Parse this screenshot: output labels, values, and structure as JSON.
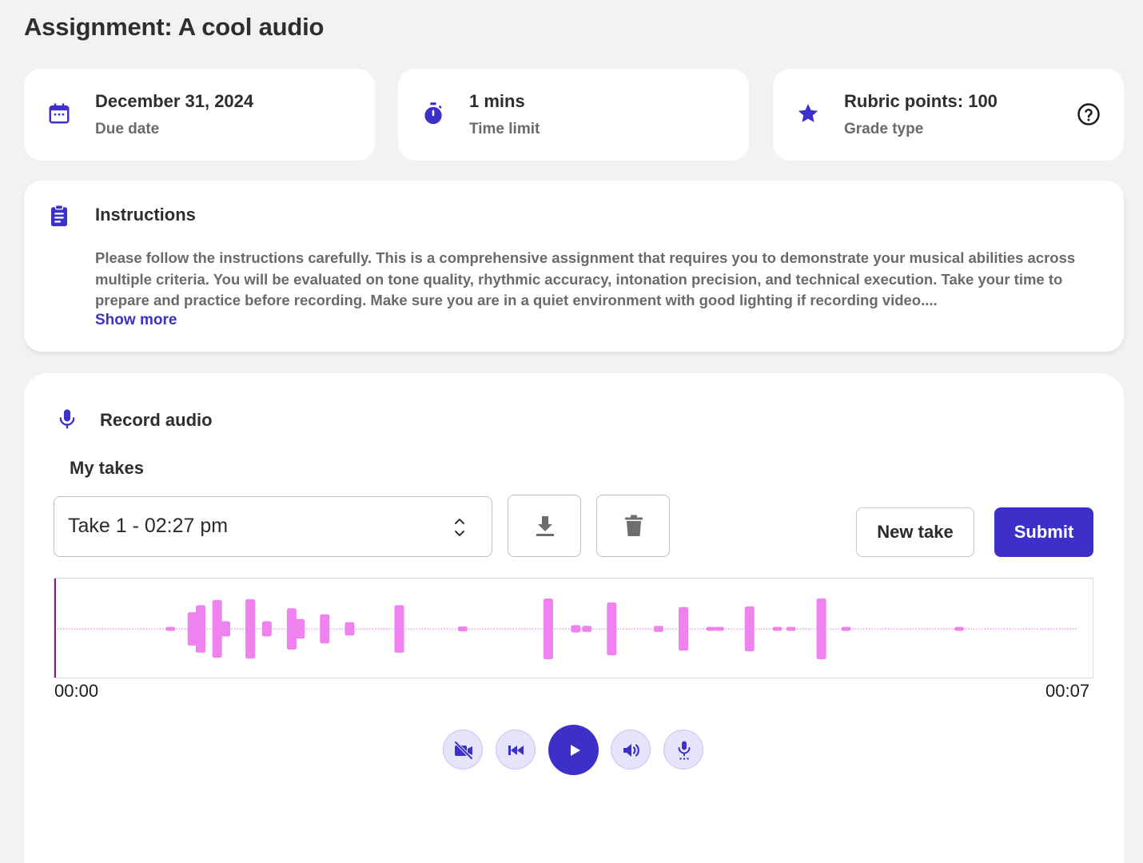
{
  "page_title": "Assignment: A cool audio",
  "info_cards": [
    {
      "icon": "calendar-icon",
      "value": "December 31, 2024",
      "label": "Due date"
    },
    {
      "icon": "stopwatch-icon",
      "value": "1 mins",
      "label": "Time limit"
    },
    {
      "icon": "star-icon",
      "value": "Rubric points: 100",
      "label": "Grade type",
      "help_icon": "help-circle-icon"
    }
  ],
  "instructions": {
    "heading": "Instructions",
    "body": "Please follow the instructions carefully. This is a comprehensive assignment that requires you to demonstrate your musical abilities across multiple criteria. You will be evaluated on tone quality, rhythmic accuracy, intonation precision, and technical execution. Take your time to prepare and practice before recording. Make sure you are in a quiet environment with good lighting if recording video....",
    "show_more": "Show more"
  },
  "recorder": {
    "title": "Record audio",
    "takes_label": "My takes",
    "selected_take": "Take 1 - 02:27 pm",
    "new_take_label": "New take",
    "submit_label": "Submit",
    "time_start": "00:00",
    "time_end": "00:07",
    "waveform_peaks": [
      0.02,
      0.02,
      0.02,
      0.02,
      0.02,
      0.02,
      0.02,
      0.02,
      0.02,
      0.02,
      0.02,
      0.02,
      0.02,
      0.02,
      0.02,
      0.02,
      0.02,
      0.02,
      0.02,
      0.02,
      0.02,
      0.02,
      0.02,
      0.02,
      0.02,
      0.02,
      0.02,
      0.02,
      0.02,
      0.02,
      0.02,
      0.02,
      0.02,
      0.02,
      0.02,
      0.02,
      0.02,
      0.02,
      0.02,
      0.02,
      0.05,
      0.02,
      0.02,
      0.02,
      0.02,
      0.02,
      0.02,
      0.02,
      0.55,
      0.02,
      0.02,
      0.78,
      0.02,
      0.02,
      0.02,
      0.02,
      0.02,
      0.95,
      0.02,
      0.02,
      0.25,
      0.02,
      0.02,
      0.02,
      0.02,
      0.02,
      0.02,
      0.02,
      0.02,
      0.98,
      0.02,
      0.02,
      0.02,
      0.02,
      0.02,
      0.25,
      0.02,
      0.02,
      0.02,
      0.02,
      0.02,
      0.02,
      0.02,
      0.02,
      0.68,
      0.02,
      0.02,
      0.32,
      0.02,
      0.02,
      0.02,
      0.02,
      0.02,
      0.02,
      0.02,
      0.02,
      0.48,
      0.02,
      0.02,
      0.02,
      0.02,
      0.02,
      0.02,
      0.02,
      0.02,
      0.22,
      0.02,
      0.02,
      0.02,
      0.02,
      0.02,
      0.02,
      0.02,
      0.02,
      0.02,
      0.02,
      0.02,
      0.02,
      0.02,
      0.02,
      0.02,
      0.02,
      0.02,
      0.78,
      0.02,
      0.02,
      0.02,
      0.02,
      0.02,
      0.02,
      0.02,
      0.02,
      0.02,
      0.02,
      0.02,
      0.02,
      0.02,
      0.02,
      0.02,
      0.02,
      0.02,
      0.02,
      0.02,
      0.02,
      0.02,
      0.02,
      0.08,
      0.02,
      0.02,
      0.02,
      0.02,
      0.02,
      0.02,
      0.02,
      0.02,
      0.02,
      0.02,
      0.02,
      0.02,
      0.02,
      0.02,
      0.02,
      0.02,
      0.02,
      0.02,
      0.02,
      0.02,
      0.02,
      0.02,
      0.02,
      0.02,
      0.02,
      0.02,
      0.02,
      0.02,
      0.02,
      0.02,
      1.0,
      0.02,
      0.02,
      0.02,
      0.02,
      0.02,
      0.02,
      0.02,
      0.02,
      0.02,
      0.12,
      0.02,
      0.02,
      0.02,
      0.1,
      0.02,
      0.02,
      0.02,
      0.02,
      0.02,
      0.02,
      0.02,
      0.02,
      0.87,
      0.02,
      0.02,
      0.02,
      0.02,
      0.02,
      0.02,
      0.02,
      0.02,
      0.02,
      0.02,
      0.02,
      0.02,
      0.02,
      0.02,
      0.02,
      0.02,
      0.1,
      0.02,
      0.02,
      0.02,
      0.02,
      0.02,
      0.02,
      0.02,
      0.02,
      0.72,
      0.02,
      0.02,
      0.02,
      0.02,
      0.02,
      0.02,
      0.02,
      0.02,
      0.02,
      0.04,
      0.02,
      0.02,
      0.04,
      0.02,
      0.02,
      0.02,
      0.02,
      0.02,
      0.02,
      0.02,
      0.02,
      0.02,
      0.02,
      0.74,
      0.02,
      0.02,
      0.02,
      0.02,
      0.02,
      0.02,
      0.02,
      0.02,
      0.02,
      0.04,
      0.02,
      0.02,
      0.02,
      0.02,
      0.04,
      0.02,
      0.02,
      0.02,
      0.02,
      0.02,
      0.02,
      0.02,
      0.02,
      0.02,
      0.02,
      1.0,
      0.02,
      0.02,
      0.02,
      0.02,
      0.02,
      0.02,
      0.02,
      0.02,
      0.06,
      0.02,
      0.02,
      0.02,
      0.02,
      0.02,
      0.02,
      0.02,
      0.02,
      0.02,
      0.02,
      0.02,
      0.02,
      0.02,
      0.02,
      0.02,
      0.02,
      0.02,
      0.02,
      0.02,
      0.02,
      0.02,
      0.02,
      0.02,
      0.02,
      0.02,
      0.02,
      0.02,
      0.02,
      0.02,
      0.02,
      0.02,
      0.02,
      0.02,
      0.02,
      0.02,
      0.02,
      0.02,
      0.02,
      0.02,
      0.02,
      0.04,
      0.02,
      0.02,
      0.02,
      0.02,
      0.02,
      0.02,
      0.02,
      0.02,
      0.02,
      0.02,
      0.02,
      0.02,
      0.02,
      0.02,
      0.02,
      0.02,
      0.02,
      0.02,
      0.02,
      0.02,
      0.02,
      0.02,
      0.02,
      0.02,
      0.02,
      0.02,
      0.02,
      0.02,
      0.02,
      0.02,
      0.02,
      0.02,
      0.02,
      0.02,
      0.02,
      0.02,
      0.02,
      0.02,
      0.02,
      0.02,
      0.02,
      0.02,
      0.02
    ],
    "controls": [
      {
        "name": "camera-off-button",
        "icon": "video-off-icon"
      },
      {
        "name": "skip-back-button",
        "icon": "skip-back-icon"
      },
      {
        "name": "play-button",
        "icon": "play-icon"
      },
      {
        "name": "volume-button",
        "icon": "volume-icon"
      },
      {
        "name": "microphone-button",
        "icon": "microphone-icon"
      }
    ]
  },
  "colors": {
    "accent": "#3d30c8",
    "waveform": "#ee82ee",
    "playhead": "#8a1a86",
    "background": "#f2f2f2"
  }
}
